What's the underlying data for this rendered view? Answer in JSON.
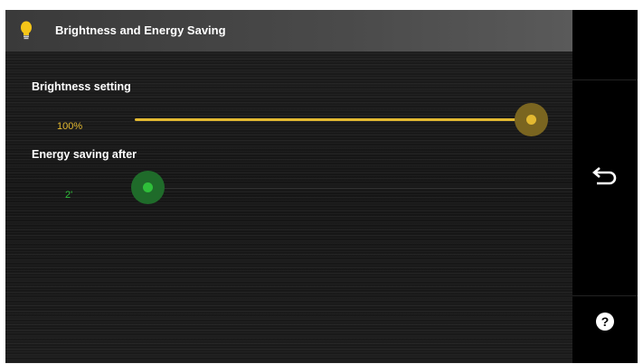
{
  "header": {
    "title": "Brightness and Energy Saving",
    "icon": "lightbulb-icon",
    "icon_color": "#f5c518"
  },
  "brightness": {
    "label": "Brightness setting",
    "value_text": "100%",
    "value_fraction": 1.0,
    "color": "#e3b931"
  },
  "energy": {
    "label": "Energy saving after",
    "value_text": "2'",
    "value_fraction": 0.0,
    "color": "#2fbf3a"
  },
  "side_rail": {
    "back_icon": "back-arrow-icon",
    "help_icon": "help-icon"
  }
}
